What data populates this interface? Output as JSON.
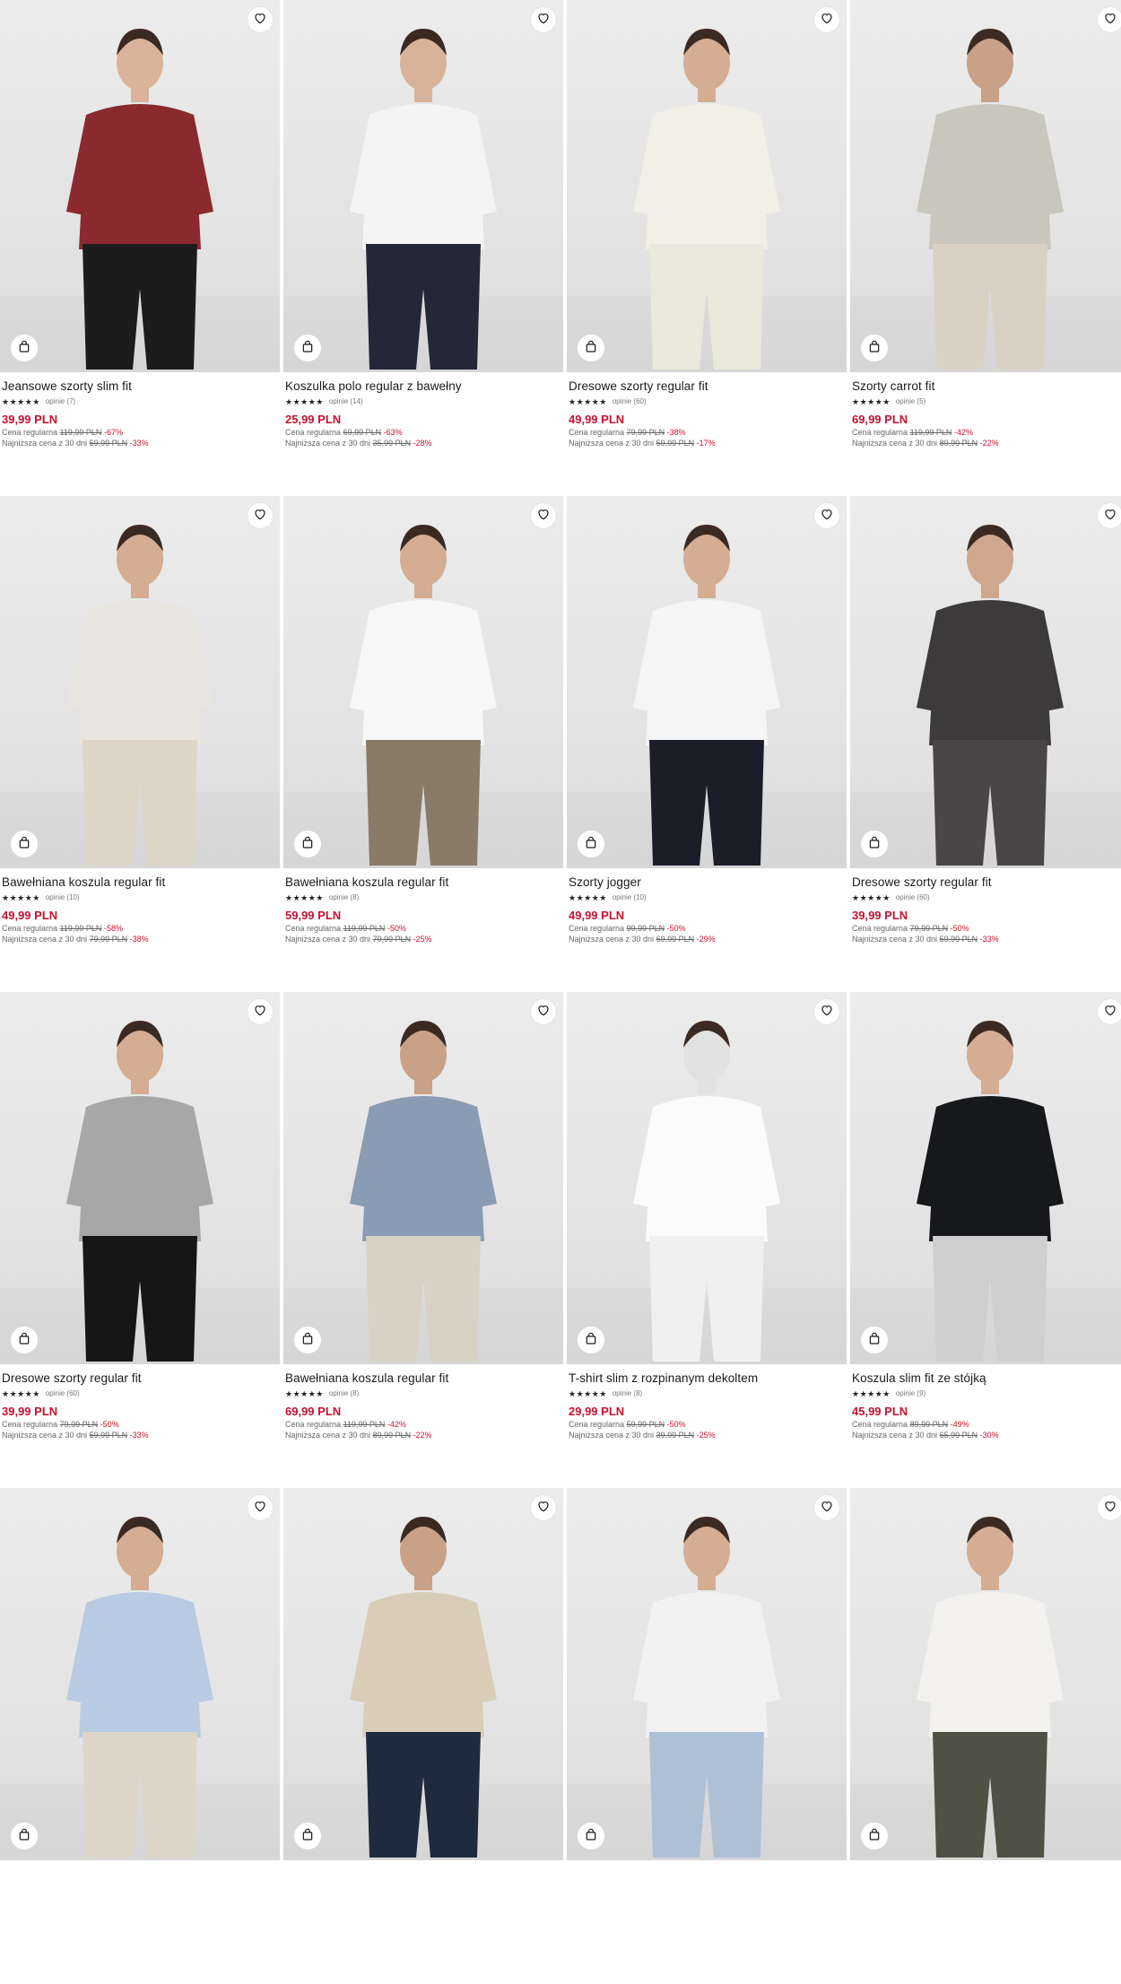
{
  "icons": {
    "favorite": "heart-outline-icon",
    "cart": "shopping-bag-icon",
    "star": "star-icon"
  },
  "colors": {
    "sale_price": "#c8102e",
    "text": "#1a1a1a",
    "muted": "#666666",
    "photo_bg": "#e6e6e6"
  },
  "products": [
    {
      "name": "Jeansowe szorty slim fit",
      "stars": "★★★★★",
      "reviews": "opinie (7)",
      "price": "39,99 PLN",
      "regular_label": "Cena regularna",
      "regular_price": "119,99 PLN",
      "regular_discount": "-67%",
      "lowest_label": "Najniższa cena z 30 dni",
      "lowest_price": "59,99 PLN",
      "lowest_discount": "-33%",
      "top": "#8a2a2e",
      "bottom": "#1c1c1c",
      "skin": "#d9b49a"
    },
    {
      "name": "Koszulka polo regular z bawełny",
      "stars": "★★★★★",
      "reviews": "opinie (14)",
      "price": "25,99 PLN",
      "regular_label": "Cena regularna",
      "regular_price": "69,99 PLN",
      "regular_discount": "-63%",
      "lowest_label": "Najniższa cena z 30 dni",
      "lowest_price": "35,99 PLN",
      "lowest_discount": "-28%",
      "top": "#f4f4f4",
      "bottom": "#232838",
      "skin": "#d8b39a"
    },
    {
      "name": "Dresowe szorty regular fit",
      "stars": "★★★★★",
      "reviews": "opinie (60)",
      "price": "49,99 PLN",
      "regular_label": "Cena regularna",
      "regular_price": "79,99 PLN",
      "regular_discount": "-38%",
      "lowest_label": "Najniższa cena z 30 dni",
      "lowest_price": "59,99 PLN",
      "lowest_discount": "-17%",
      "top": "#f1efe6",
      "bottom": "#ebe8dc",
      "skin": "#d4ad93"
    },
    {
      "name": "Szorty carrot fit",
      "stars": "★★★★★",
      "reviews": "opinie (5)",
      "price": "69,99 PLN",
      "regular_label": "Cena regularna",
      "regular_price": "119,99 PLN",
      "regular_discount": "-42%",
      "lowest_label": "Najniższa cena z 30 dni",
      "lowest_price": "89,99 PLN",
      "lowest_discount": "-22%",
      "top": "#c9c6bd",
      "bottom": "#d9d1c4",
      "skin": "#c9a187"
    },
    {
      "name": "Bawełniana koszula regular fit",
      "stars": "★★★★★",
      "reviews": "opinie (10)",
      "price": "49,99 PLN",
      "regular_label": "Cena regularna",
      "regular_price": "119,99 PLN",
      "regular_discount": "-58%",
      "lowest_label": "Najniższa cena z 30 dni",
      "lowest_price": "79,99 PLN",
      "lowest_discount": "-38%",
      "top": "#e9e6e1",
      "bottom": "#ddd5c6",
      "skin": "#d4ad93"
    },
    {
      "name": "Bawełniana koszula regular fit",
      "stars": "★★★★★",
      "reviews": "opinie (8)",
      "price": "59,99 PLN",
      "regular_label": "Cena regularna",
      "regular_price": "119,99 PLN",
      "regular_discount": "-50%",
      "lowest_label": "Najniższa cena z 30 dni",
      "lowest_price": "79,99 PLN",
      "lowest_discount": "-25%",
      "top": "#f7f7f7",
      "bottom": "#8a7a68",
      "skin": "#d4ad93"
    },
    {
      "name": "Szorty jogger",
      "stars": "★★★★★",
      "reviews": "opinie (10)",
      "price": "49,99 PLN",
      "regular_label": "Cena regularna",
      "regular_price": "99,99 PLN",
      "regular_discount": "-50%",
      "lowest_label": "Najniższa cena z 30 dni",
      "lowest_price": "69,99 PLN",
      "lowest_discount": "-29%",
      "top": "#f5f5f5",
      "bottom": "#1b1e28",
      "skin": "#d4ad93"
    },
    {
      "name": "Dresowe szorty regular fit",
      "stars": "★★★★★",
      "reviews": "opinie (60)",
      "price": "39,99 PLN",
      "regular_label": "Cena regularna",
      "regular_price": "79,99 PLN",
      "regular_discount": "-50%",
      "lowest_label": "Najniższa cena z 30 dni",
      "lowest_price": "59,99 PLN",
      "lowest_discount": "-33%",
      "top": "#3d3a3b",
      "bottom": "#4a4647",
      "skin": "#cfa78d"
    },
    {
      "name": "Dresowe szorty regular fit",
      "stars": "★★★★★",
      "reviews": "opinie (60)",
      "price": "39,99 PLN",
      "regular_label": "Cena regularna",
      "regular_price": "79,99 PLN",
      "regular_discount": "-50%",
      "lowest_label": "Najniższa cena z 30 dni",
      "lowest_price": "59,99 PLN",
      "lowest_discount": "-33%",
      "top": "#a7a7a7",
      "bottom": "#161616",
      "skin": "#d4ad93"
    },
    {
      "name": "Bawełniana koszula regular fit",
      "stars": "★★★★★",
      "reviews": "opinie (8)",
      "price": "69,99 PLN",
      "regular_label": "Cena regularna",
      "regular_price": "119,99 PLN",
      "regular_discount": "-42%",
      "lowest_label": "Najniższa cena z 30 dni",
      "lowest_price": "89,99 PLN",
      "lowest_discount": "-22%",
      "top": "#8a9bb4",
      "bottom": "#d8d2c4",
      "skin": "#c9a187"
    },
    {
      "name": "T-shirt slim z rozpinanym dekoltem",
      "stars": "★★★★★",
      "reviews": "opinie (8)",
      "price": "29,99 PLN",
      "regular_label": "Cena regularna",
      "regular_price": "59,99 PLN",
      "regular_discount": "-50%",
      "lowest_label": "Najniższa cena z 30 dni",
      "lowest_price": "39,99 PLN",
      "lowest_discount": "-25%",
      "top": "#fbfbfb",
      "bottom": "#f0f0f0",
      "skin": "#e2e2e2"
    },
    {
      "name": "Koszula slim fit ze stójką",
      "stars": "★★★★★",
      "reviews": "opinie (9)",
      "price": "45,99 PLN",
      "regular_label": "Cena regularna",
      "regular_price": "89,99 PLN",
      "regular_discount": "-49%",
      "lowest_label": "Najniższa cena z 30 dni",
      "lowest_price": "65,99 PLN",
      "lowest_discount": "-30%",
      "top": "#17181b",
      "bottom": "#cfcfcf",
      "skin": "#d4ad93"
    },
    {
      "name": "",
      "stars": "",
      "reviews": "",
      "price": "",
      "regular_label": "",
      "regular_price": "",
      "regular_discount": "",
      "lowest_label": "",
      "lowest_price": "",
      "lowest_discount": "",
      "top": "#b9cbe3",
      "bottom": "#ddd6c8",
      "skin": "#d4ad93"
    },
    {
      "name": "",
      "stars": "",
      "reviews": "",
      "price": "",
      "regular_label": "",
      "regular_price": "",
      "regular_discount": "",
      "lowest_label": "",
      "lowest_price": "",
      "lowest_discount": "",
      "top": "#d9cdb8",
      "bottom": "#1e2a3e",
      "skin": "#c9a187"
    },
    {
      "name": "",
      "stars": "",
      "reviews": "",
      "price": "",
      "regular_label": "",
      "regular_price": "",
      "regular_discount": "",
      "lowest_label": "",
      "lowest_price": "",
      "lowest_discount": "",
      "top": "#f2f2f2",
      "bottom": "#aec0d6",
      "skin": "#d4ad93"
    },
    {
      "name": "",
      "stars": "",
      "reviews": "",
      "price": "",
      "regular_label": "",
      "regular_price": "",
      "regular_discount": "",
      "lowest_label": "",
      "lowest_price": "",
      "lowest_discount": "",
      "top": "#f4f2ee",
      "bottom": "#4f5144",
      "skin": "#d4ad93"
    }
  ]
}
